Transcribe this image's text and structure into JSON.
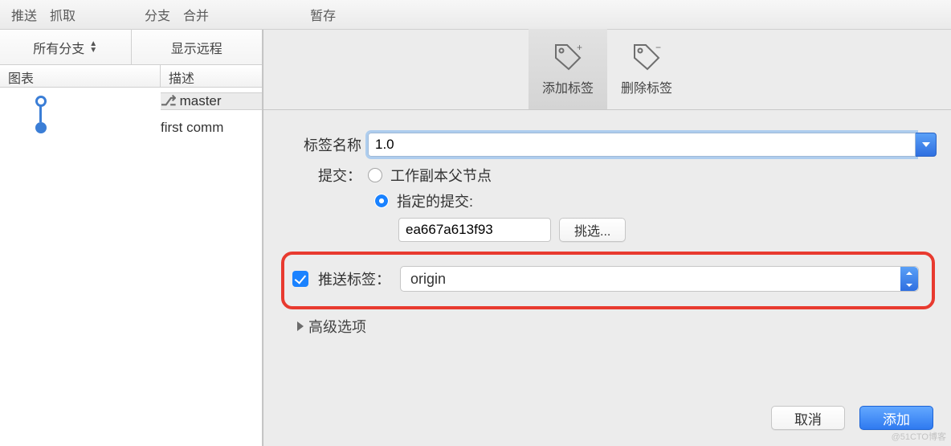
{
  "topbar": {
    "push": "推送",
    "fetch": "抓取",
    "branch": "分支",
    "merge": "合并",
    "stash": "暂存"
  },
  "filter": {
    "all_branches": "所有分支",
    "show_remote": "显示远程"
  },
  "table": {
    "col_graph": "图表",
    "col_desc": "描述"
  },
  "commits": [
    {
      "branch_label": "master",
      "is_head": true
    },
    {
      "desc": "first comm"
    }
  ],
  "tabs": {
    "add": "添加标签",
    "remove": "删除标签"
  },
  "form": {
    "name_label": "标签名称",
    "name_value": "1.0",
    "commit_label": "提交：",
    "radio_working_copy": "工作副本父节点",
    "radio_specified": "指定的提交:",
    "commit_hash": "ea667a613f93",
    "pick": "挑选...",
    "push_tag_label": "推送标签：",
    "push_tag_checked": true,
    "remote_value": "origin",
    "advanced": "高级选项"
  },
  "buttons": {
    "cancel": "取消",
    "add": "添加"
  },
  "watermark": "@51CTO博客"
}
